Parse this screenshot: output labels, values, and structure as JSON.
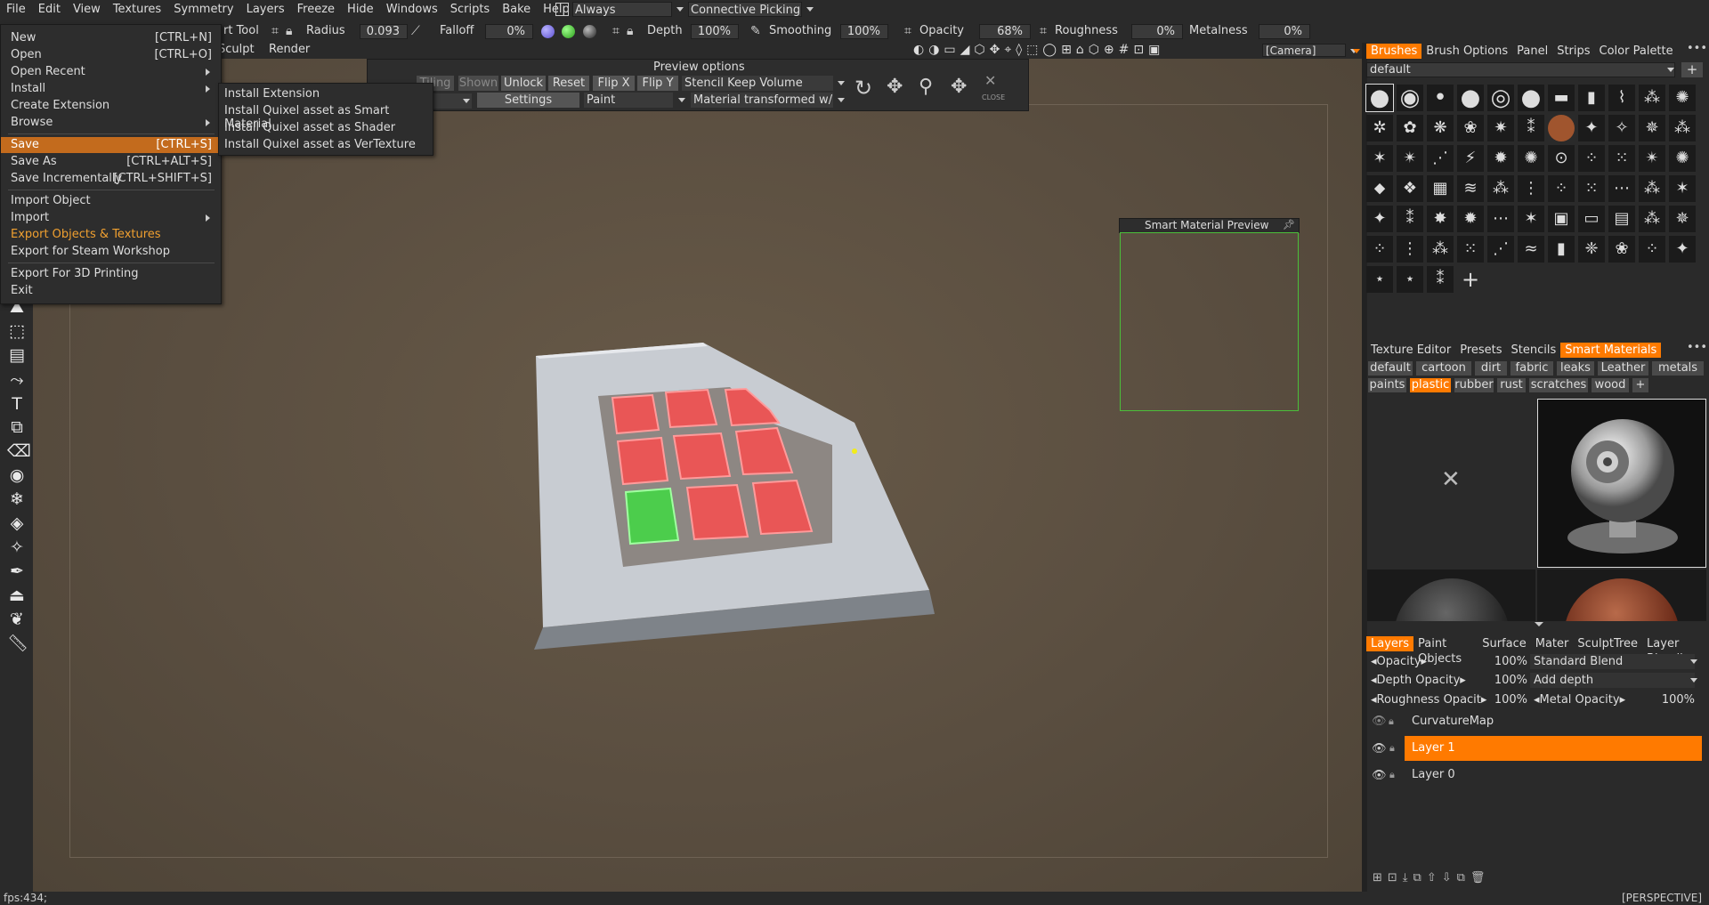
{
  "menubar": {
    "items": [
      "File",
      "Edit",
      "View",
      "Textures",
      "Symmetry",
      "Layers",
      "Freeze",
      "Hide",
      "Windows",
      "Scripts",
      "Bake",
      "Help"
    ],
    "always_label": "Always",
    "picking_label": "Connective Picking"
  },
  "toolbar": {
    "tool_label": "rt  Tool",
    "radius_label": "Radius",
    "radius_value": "0.093",
    "falloff_label": "Falloff",
    "falloff_value": "0%",
    "depth_label": "Depth",
    "depth_value": "100%",
    "smoothing_label": "Smoothing",
    "smoothing_value": "100%",
    "opacity_label": "Opacity",
    "opacity_value": "68%",
    "roughness_label": "Roughness",
    "roughness_value": "0%",
    "metalness_label": "Metalness",
    "metalness_value": "0%",
    "sculpt_tab": "Sculpt",
    "render_tab": "Render",
    "camera_label": "[Camera]"
  },
  "file_menu": {
    "items": [
      {
        "label": "New",
        "shortcut": "[CTRL+N]"
      },
      {
        "label": "Open",
        "shortcut": "[CTRL+O]"
      },
      {
        "label": "Open  Recent",
        "shortcut": ""
      },
      {
        "label": "Install",
        "shortcut": ""
      },
      {
        "label": "Create  Extension",
        "shortcut": ""
      },
      {
        "label": "Browse",
        "shortcut": ""
      },
      {
        "label": "Save",
        "shortcut": "[CTRL+S]"
      },
      {
        "label": "Save  As",
        "shortcut": "[CTRL+ALT+S]"
      },
      {
        "label": "Save  Incrementally",
        "shortcut": "[CTRL+SHIFT+S]"
      },
      {
        "label": "Import  Object",
        "shortcut": ""
      },
      {
        "label": "Import",
        "shortcut": ""
      },
      {
        "label": "Export  Objects  &  Textures",
        "shortcut": ""
      },
      {
        "label": "Export  for  Steam  Workshop",
        "shortcut": ""
      },
      {
        "label": "Export  For  3D  Printing",
        "shortcut": ""
      },
      {
        "label": "Exit",
        "shortcut": ""
      }
    ]
  },
  "install_submenu": [
    "Install  Extension",
    "Install  Quixel  asset  as  Smart  Material",
    "Install  Quixel  asset  as  Shader",
    "Install  Quixel  asset  as  VerTexture"
  ],
  "preview_options": {
    "title": "Preview  options",
    "tiling": "Tiling",
    "shown": "Shown",
    "unlock": "Unlock",
    "reset": "Reset",
    "flip_x": "Flip  X",
    "flip_y": "Flip  Y",
    "stencil_mode": "Stencil  Keep  Volume",
    "settings": "Settings",
    "paint": "Paint",
    "material_mode": "Material  transformed  w/",
    "close": "CLOSE"
  },
  "smart_material_preview": {
    "title": "Smart  Material  Preview"
  },
  "brushes_panel": {
    "tabs": [
      "Brushes",
      "Brush  Options",
      "Panel",
      "Strips",
      "Color  Palette"
    ],
    "preset": "default"
  },
  "materials_panel": {
    "tabs": [
      "Texture  Editor",
      "Presets",
      "Stencils",
      "Smart  Materials"
    ],
    "chips_row1": [
      "default",
      "cartoon",
      "dirt",
      "fabric",
      "leaks",
      "Leather",
      "metals"
    ],
    "chips_row2": [
      "paints",
      "plastic",
      "rubber",
      "rust",
      "scratches",
      "wood"
    ]
  },
  "layers_panel": {
    "tabs": [
      "Layers",
      "Paint  Objects",
      "Surface",
      "Mater",
      "SculptTree",
      "Layer  Blendin"
    ],
    "opacity_label": "Opacity",
    "opacity_value": "100%",
    "blend_mode": "Standard  Blend",
    "depth_opacity_label": "Depth  Opacity",
    "depth_opacity_value": "100%",
    "depth_mode": "Add  depth",
    "roughness_opacity_label": "Roughness  Opacit",
    "roughness_opacity_value": "100%",
    "metal_opacity_label": "Metal  Opacity",
    "metal_opacity_value": "100%",
    "layers": [
      "CurvatureMap",
      "Layer  1",
      "Layer  0"
    ]
  },
  "status": {
    "fps": "fps:434;",
    "projection": "[PERSPECTIVE]"
  },
  "colors": {
    "accent": "#ff7a00",
    "selected_menu": "#c36b1d",
    "highlight_text": "#f0a030"
  }
}
